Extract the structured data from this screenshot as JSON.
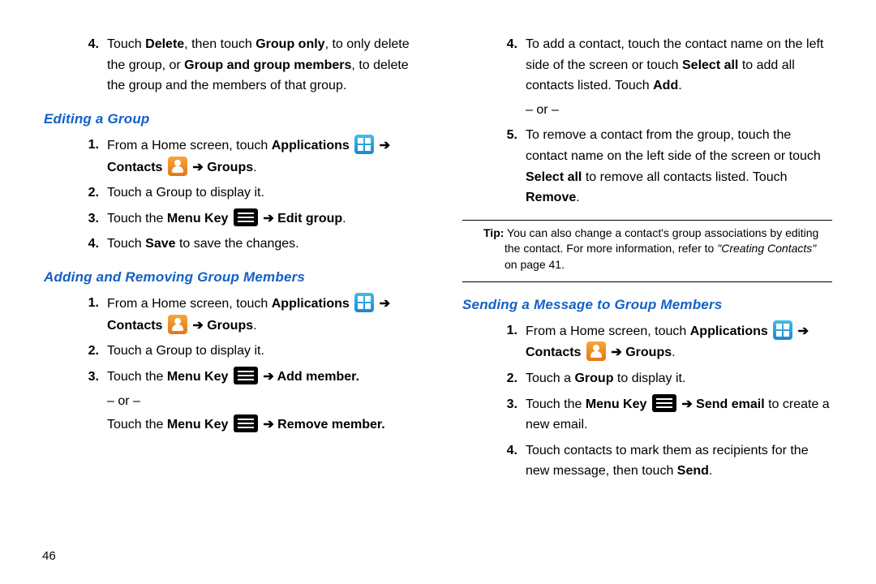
{
  "page_number": "46",
  "left": {
    "intro_item": {
      "num": "4.",
      "parts": [
        "Touch ",
        "Delete",
        ", then touch ",
        "Group only",
        ", to only delete the group, or ",
        "Group and group members",
        ", to delete the group and the members of that group."
      ]
    },
    "heading_edit": "Editing a Group",
    "edit_steps": [
      {
        "num": "1.",
        "parts": [
          "From a Home screen, touch ",
          "Applications",
          " ",
          "@apps",
          " ",
          "➔ ",
          "Contacts",
          " ",
          "@contacts",
          " ",
          "➔ ",
          "Groups",
          "."
        ]
      },
      {
        "num": "2.",
        "parts": [
          "Touch a Group to display it."
        ]
      },
      {
        "num": "3.",
        "parts": [
          "Touch the ",
          "Menu Key",
          " ",
          "@menu",
          " ",
          "➔ ",
          "Edit group",
          "."
        ]
      },
      {
        "num": "4.",
        "parts": [
          "Touch ",
          "Save",
          " to save the changes."
        ]
      }
    ],
    "heading_addremove": "Adding and Removing Group Members",
    "addremove_steps": [
      {
        "num": "1.",
        "parts": [
          "From a Home screen, touch ",
          "Applications",
          " ",
          "@apps",
          " ",
          "➔ ",
          "Contacts",
          " ",
          "@contacts",
          " ",
          "➔ ",
          "Groups",
          "."
        ]
      },
      {
        "num": "2.",
        "parts": [
          "Touch a Group to display it."
        ]
      },
      {
        "num": "3.",
        "parts": [
          "Touch the ",
          "Menu Key",
          " ",
          "@menu",
          " ",
          "➔ ",
          "Add member."
        ],
        "sub_or": "– or –",
        "sub_parts": [
          "Touch the ",
          "Menu Key",
          " ",
          "@menu",
          " ",
          "➔ ",
          "Remove member."
        ]
      }
    ]
  },
  "right": {
    "cont_items": [
      {
        "num": "4.",
        "parts": [
          "To add a contact, touch the contact name on the left side of the screen or touch ",
          "Select all",
          " to add all contacts listed. Touch ",
          "Add",
          "."
        ],
        "sub_or": "– or –"
      },
      {
        "num": "5.",
        "parts": [
          "To remove a contact from the group, touch the contact name on the left side of the screen or touch ",
          "Select all",
          " to remove all contacts listed. Touch ",
          "Remove",
          "."
        ]
      }
    ],
    "tip_label": "Tip:",
    "tip_text_a": " You can also change a contact's group associations by editing the contact. For more information, refer to ",
    "tip_text_ref": "\"Creating Contacts\"",
    "tip_text_b": "  on page 41.",
    "heading_sendmsg": "Sending a Message to Group Members",
    "send_steps": [
      {
        "num": "1.",
        "parts": [
          "From a Home screen, touch ",
          "Applications",
          " ",
          "@apps",
          " ",
          "➔ ",
          "Contacts",
          " ",
          "@contacts",
          " ",
          "➔ ",
          "Groups",
          "."
        ]
      },
      {
        "num": "2.",
        "parts": [
          "Touch a ",
          "Group",
          " to display it."
        ]
      },
      {
        "num": "3.",
        "parts": [
          "Touch the ",
          "Menu Key",
          " ",
          "@menu",
          " ",
          "➔ ",
          "Send email",
          " to create a new email."
        ]
      },
      {
        "num": "4.",
        "parts": [
          "Touch contacts to mark them as recipients for the new message, then touch ",
          "Send",
          "."
        ]
      }
    ]
  }
}
